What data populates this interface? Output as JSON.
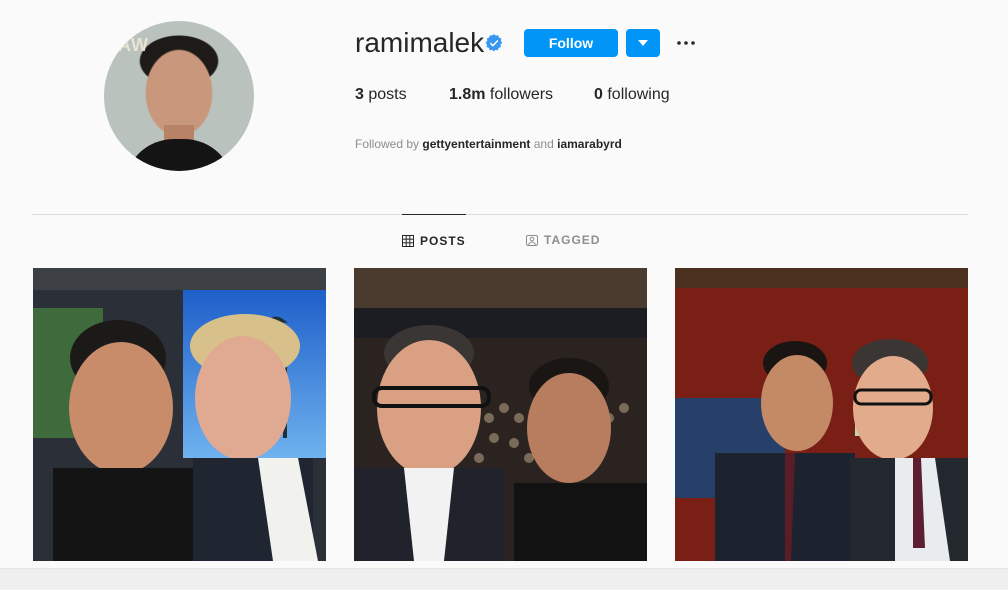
{
  "profile": {
    "username": "ramimalek",
    "verified_icon": "verified-badge-icon",
    "follow_label": "Follow",
    "dropdown_icon": "chevron-down-icon",
    "more_icon": "more-horizontal-icon",
    "accent": "#0095f6"
  },
  "stats": [
    {
      "count": "3",
      "label": "posts"
    },
    {
      "count": "1.8m",
      "label": "followers"
    },
    {
      "count": "0",
      "label": "following"
    }
  ],
  "followed_by": {
    "prefix": "Followed by",
    "accounts": [
      "gettyentertainment",
      "iamarabyrd"
    ],
    "joiner": "and"
  },
  "tabs": [
    {
      "label": "POSTS",
      "icon": "grid-icon",
      "active": true
    },
    {
      "label": "TAGGED",
      "icon": "tagged-icon",
      "active": false
    }
  ],
  "posts": [
    {
      "name": "post-selfie-ellen"
    },
    {
      "name": "post-selfie-colbert-audience"
    },
    {
      "name": "post-selfie-colbert-set"
    }
  ]
}
